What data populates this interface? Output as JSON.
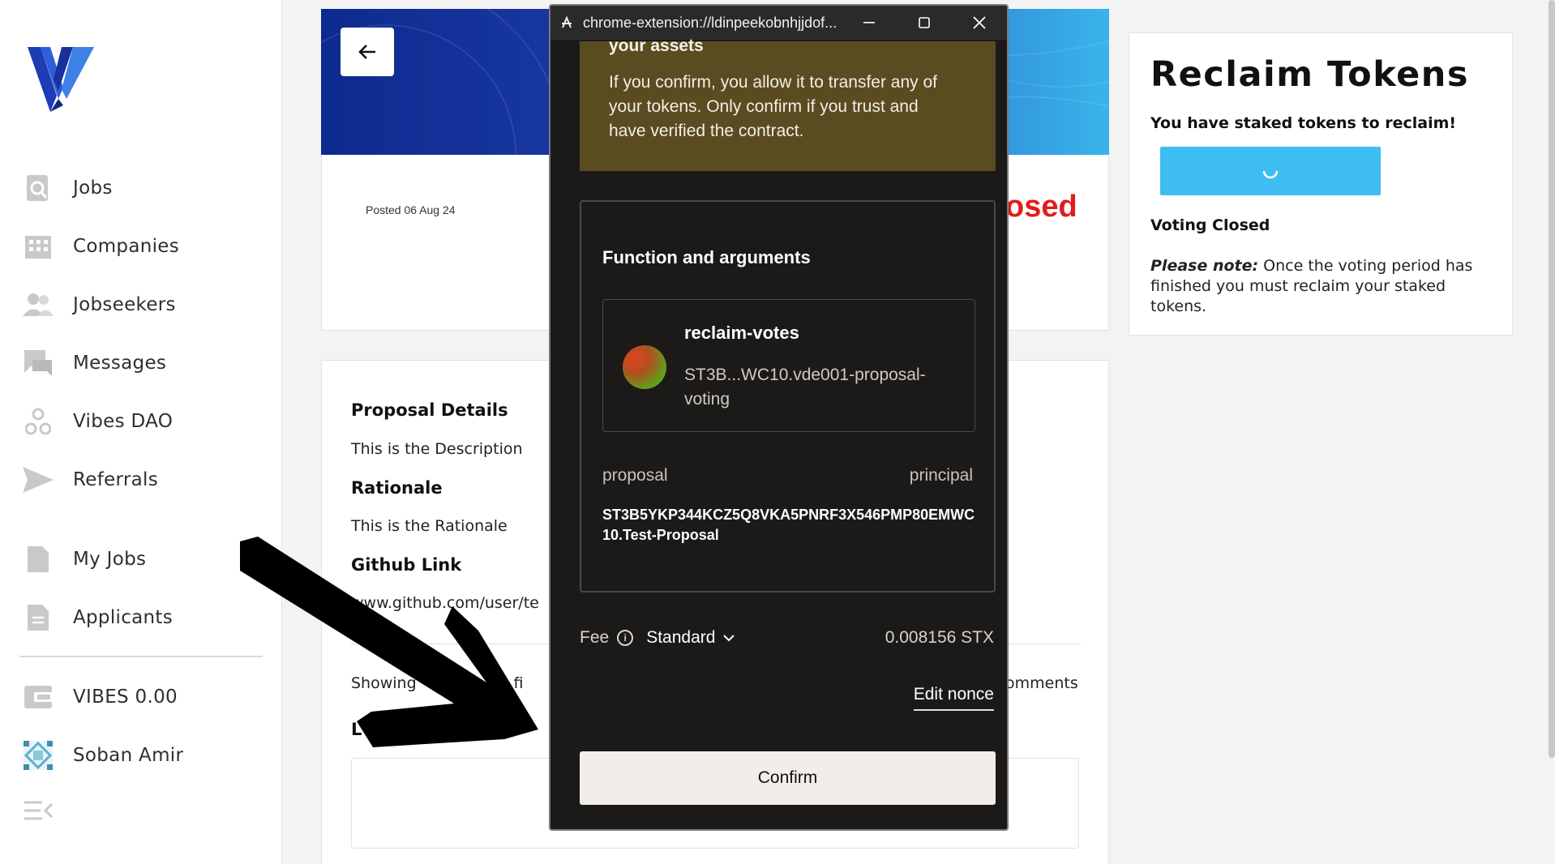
{
  "sidebar": {
    "items": [
      {
        "label": "Jobs",
        "icon": "search-doc-icon"
      },
      {
        "label": "Companies",
        "icon": "building-icon"
      },
      {
        "label": "Jobseekers",
        "icon": "people-icon"
      },
      {
        "label": "Messages",
        "icon": "chat-icon"
      },
      {
        "label": "Vibes DAO",
        "icon": "dao-icon"
      },
      {
        "label": "Referrals",
        "icon": "send-icon"
      },
      {
        "label": "My Jobs",
        "icon": "file-icon"
      },
      {
        "label": "Applicants",
        "icon": "document-icon"
      },
      {
        "label": "VIBES 0.00",
        "icon": "wallet-icon"
      },
      {
        "label": "Soban Amir",
        "icon": "avatar-icon"
      }
    ]
  },
  "proposal": {
    "posted": "Posted 06 Aug 24",
    "status_fragment": "osed",
    "details_heading": "Proposal Details",
    "description": "This is the Description",
    "rationale_heading": "Rationale",
    "rationale": "This is the Rationale",
    "github_heading": "Github Link",
    "github_url": "www.github.com/user/te",
    "showing_text": "Showing",
    "showing_text_2": "t fi",
    "comments_text": "omments",
    "l_fragment": "L"
  },
  "reclaim": {
    "title": "Reclaim Tokens",
    "subtitle": "You have staked tokens to reclaim!",
    "voting_status": "Voting Closed",
    "note_label": "Please note:",
    "note_text": " Once the voting period has finished you must reclaim your staked tokens."
  },
  "popup": {
    "url": "chrome-extension://ldinpeekobnhjjdof...",
    "warning_cut": "your assets",
    "warning_text": "If you confirm, you allow it to transfer any of your tokens. Only confirm if you trust and have verified the contract.",
    "function_heading": "Function and arguments",
    "function_name": "reclaim-votes",
    "contract": "ST3B...WC10.vde001-proposal-voting",
    "arg_key": "proposal",
    "arg_type": "principal",
    "arg_value": "ST3B5YKP344KCZ5Q8VKA5PNRF3X546PMP80EMWC10.Test-Proposal",
    "fee_label": "Fee",
    "fee_speed": "Standard",
    "fee_amount": "0.008156 STX",
    "edit_nonce": "Edit nonce",
    "confirm": "Confirm"
  },
  "colors": {
    "accent_blue": "#3dbdf0",
    "closed_red": "#e31b1b",
    "warning_bg": "#5a4b21",
    "popup_bg": "#1c1a19"
  }
}
